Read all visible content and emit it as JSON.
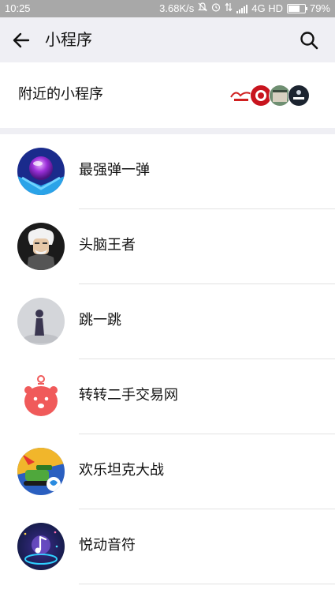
{
  "status_bar": {
    "time": "10:25",
    "speed": "3.68K/s",
    "network": "4G HD",
    "battery": "79%",
    "battery_level": 0.79
  },
  "header": {
    "title": "小程序",
    "back_icon": "arrow-left-icon",
    "search_icon": "search-icon"
  },
  "nearby": {
    "label": "附近的小程序"
  },
  "apps": [
    {
      "name": "最强弹一弹"
    },
    {
      "name": "头脑王者"
    },
    {
      "name": "跳一跳"
    },
    {
      "name": "转转二手交易网"
    },
    {
      "name": "欢乐坦克大战"
    },
    {
      "name": "悦动音符"
    }
  ]
}
